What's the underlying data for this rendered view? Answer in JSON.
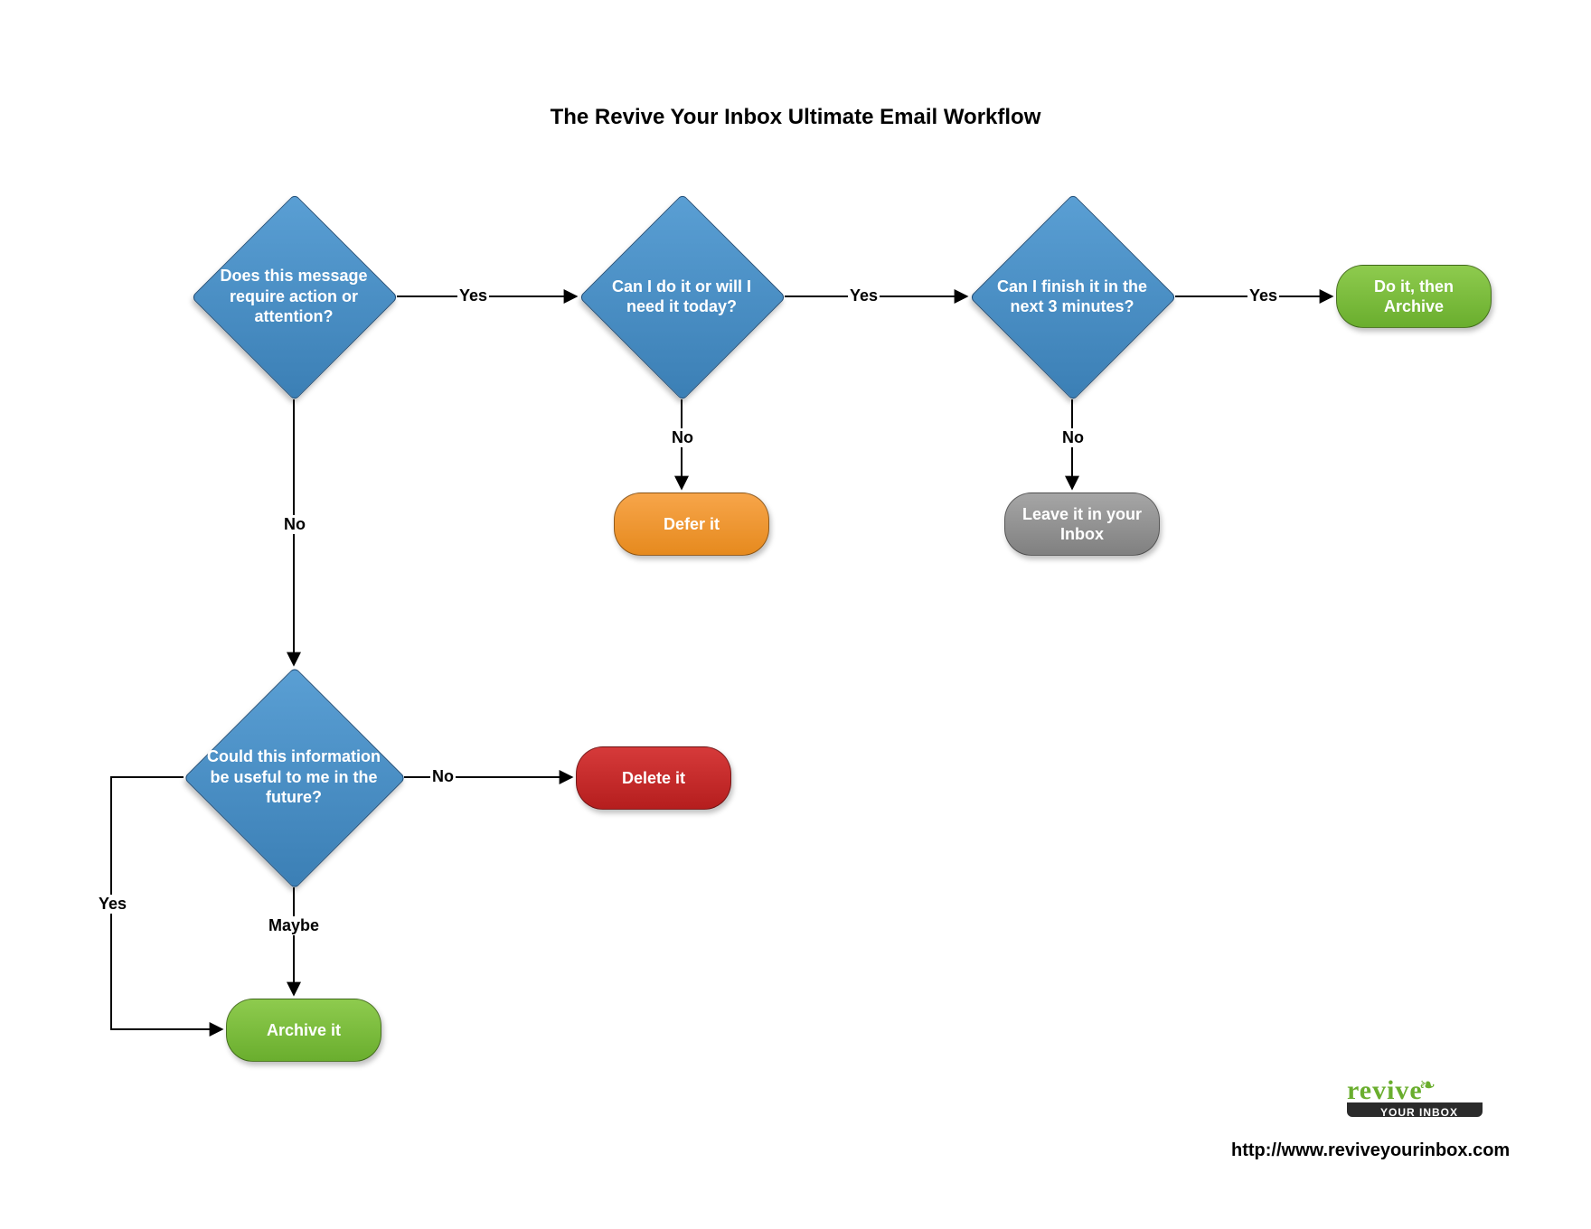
{
  "title": "The Revive Your Inbox Ultimate Email Workflow",
  "decisions": {
    "d1": "Does this message require action or attention?",
    "d2": "Can I do it or will I need it today?",
    "d3": "Can I finish it in the next 3 minutes?",
    "d4": "Could this information be useful to me in the future?"
  },
  "terminals": {
    "doArchive": "Do it, then Archive",
    "defer": "Defer it",
    "leave": "Leave it in your Inbox",
    "delete": "Delete it",
    "archive": "Archive it"
  },
  "edges": {
    "yes": "Yes",
    "no": "No",
    "maybe": "Maybe"
  },
  "logo": {
    "word": "revive",
    "sub": "YOUR INBOX"
  },
  "url": "http://www.reviveyourinbox.com",
  "chart_data": {
    "type": "flowchart",
    "title": "The Revive Your Inbox Ultimate Email Workflow",
    "nodes": [
      {
        "id": "d1",
        "kind": "decision",
        "text": "Does this message require action or attention?"
      },
      {
        "id": "d2",
        "kind": "decision",
        "text": "Can I do it or will I need it today?"
      },
      {
        "id": "d3",
        "kind": "decision",
        "text": "Can I finish it in the next 3 minutes?"
      },
      {
        "id": "d4",
        "kind": "decision",
        "text": "Could this information be useful to me in the future?"
      },
      {
        "id": "tDoArchive",
        "kind": "terminal",
        "color": "green",
        "text": "Do it, then Archive"
      },
      {
        "id": "tDefer",
        "kind": "terminal",
        "color": "orange",
        "text": "Defer it"
      },
      {
        "id": "tLeave",
        "kind": "terminal",
        "color": "gray",
        "text": "Leave it in your Inbox"
      },
      {
        "id": "tDelete",
        "kind": "terminal",
        "color": "red",
        "text": "Delete it"
      },
      {
        "id": "tArchive",
        "kind": "terminal",
        "color": "green",
        "text": "Archive it"
      }
    ],
    "edges": [
      {
        "from": "d1",
        "to": "d2",
        "label": "Yes"
      },
      {
        "from": "d1",
        "to": "d4",
        "label": "No"
      },
      {
        "from": "d2",
        "to": "d3",
        "label": "Yes"
      },
      {
        "from": "d2",
        "to": "tDefer",
        "label": "No"
      },
      {
        "from": "d3",
        "to": "tDoArchive",
        "label": "Yes"
      },
      {
        "from": "d3",
        "to": "tLeave",
        "label": "No"
      },
      {
        "from": "d4",
        "to": "tDelete",
        "label": "No"
      },
      {
        "from": "d4",
        "to": "tArchive",
        "label": "Yes"
      },
      {
        "from": "d4",
        "to": "tArchive",
        "label": "Maybe"
      }
    ]
  }
}
